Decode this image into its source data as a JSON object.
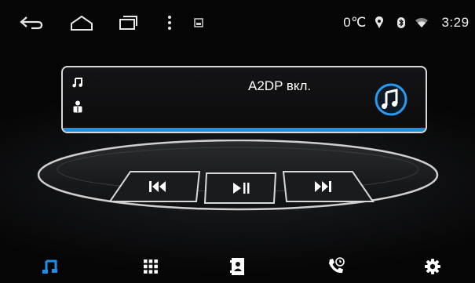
{
  "status_bar": {
    "temperature": "0℃",
    "time": "3:29"
  },
  "now_playing": {
    "title": "A2DP вкл."
  },
  "colors": {
    "accent": "#1f8fe0",
    "background": "#0a0a0a"
  },
  "icons": {
    "top_left": [
      "back-icon",
      "home-icon",
      "recent-apps-icon",
      "overflow-menu-icon",
      "screenshot-icon"
    ],
    "top_right": [
      "location-icon",
      "bluetooth-icon",
      "wifi-icon"
    ],
    "controls": [
      "previous-track-icon",
      "play-pause-icon",
      "next-track-icon"
    ],
    "bottom_nav": [
      "music-icon",
      "apps-grid-icon",
      "contacts-icon",
      "call-history-icon",
      "settings-icon"
    ]
  }
}
